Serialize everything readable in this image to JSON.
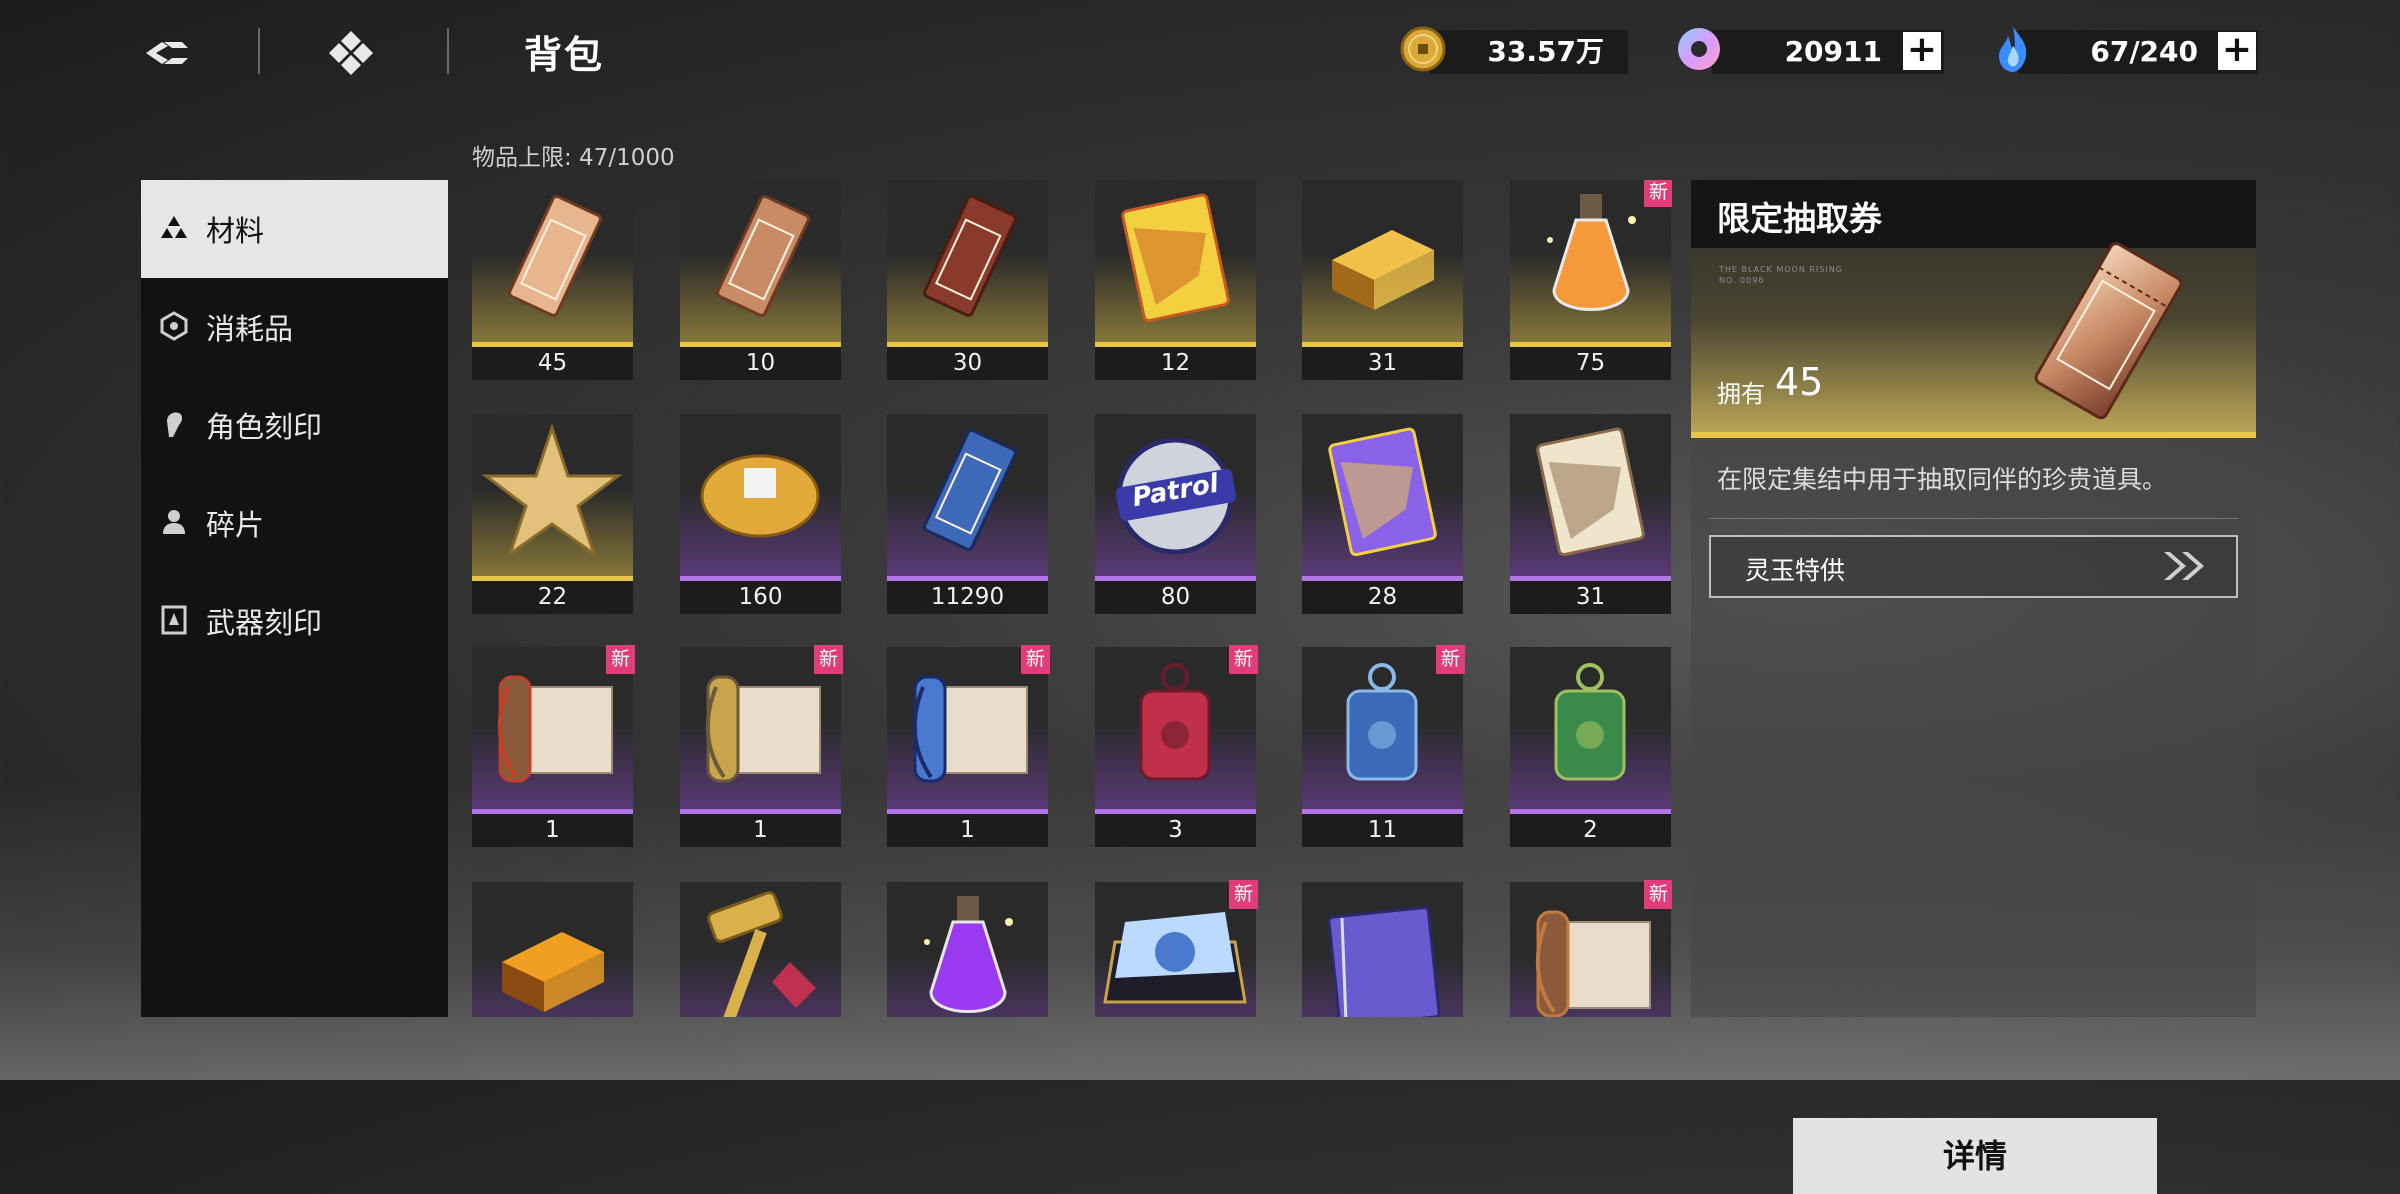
{
  "header": {
    "title": "背包",
    "resources": [
      {
        "icon": "gold-coin-icon",
        "value": "33.57万",
        "has_plus": false
      },
      {
        "icon": "jade-ring-icon",
        "value": "20911",
        "has_plus": true
      },
      {
        "icon": "blue-flame-icon",
        "value": "67/240",
        "has_plus": true
      }
    ],
    "plus_label": "+"
  },
  "sidebar": {
    "items": [
      {
        "label": "材料",
        "icon": "materials-icon",
        "active": true
      },
      {
        "label": "消耗品",
        "icon": "consumables-icon",
        "active": false
      },
      {
        "label": "角色刻印",
        "icon": "character-imprint-icon",
        "active": false
      },
      {
        "label": "碎片",
        "icon": "fragment-icon",
        "active": false
      },
      {
        "label": "武器刻印",
        "icon": "weapon-imprint-icon",
        "active": false
      }
    ]
  },
  "inventory": {
    "limit_text": "物品上限: 47/1000",
    "new_badge": "新",
    "items": [
      {
        "icon": "gold-ticket-icon",
        "count": "45",
        "rarity": "gold",
        "new": false,
        "selected": true
      },
      {
        "icon": "bronze-ticket-icon",
        "count": "10",
        "rarity": "gold",
        "new": false
      },
      {
        "icon": "star-ticket-icon",
        "count": "30",
        "rarity": "gold",
        "new": false
      },
      {
        "icon": "gold-book-icon",
        "count": "12",
        "rarity": "gold",
        "new": false
      },
      {
        "icon": "gold-ingot-icon",
        "count": "31",
        "rarity": "gold",
        "new": false
      },
      {
        "icon": "potion-bottle-icon",
        "count": "75",
        "rarity": "gold",
        "new": true
      },
      {
        "icon": "gold-star-icon",
        "count": "22",
        "rarity": "gold",
        "new": false
      },
      {
        "icon": "thread-spool-icon",
        "count": "160",
        "rarity": "purple",
        "new": false
      },
      {
        "icon": "blue-ticket-icon",
        "count": "11290",
        "rarity": "purple",
        "new": false
      },
      {
        "icon": "patrol-badge-icon",
        "count": "80",
        "rarity": "purple",
        "new": false,
        "text": "Patrol"
      },
      {
        "icon": "purple-book-icon",
        "count": "28",
        "rarity": "purple",
        "new": false
      },
      {
        "icon": "scroll-book-icon",
        "count": "31",
        "rarity": "purple",
        "new": false
      },
      {
        "icon": "brown-scroll-icon",
        "count": "1",
        "rarity": "purple",
        "new": true
      },
      {
        "icon": "gold-scroll-icon",
        "count": "1",
        "rarity": "purple",
        "new": true
      },
      {
        "icon": "blue-scroll-icon",
        "count": "1",
        "rarity": "purple",
        "new": true
      },
      {
        "icon": "red-charm-icon",
        "count": "3",
        "rarity": "purple",
        "new": true
      },
      {
        "icon": "blue-charm-icon",
        "count": "11",
        "rarity": "purple",
        "new": true
      },
      {
        "icon": "green-charm-icon",
        "count": "2",
        "rarity": "purple",
        "new": false
      },
      {
        "icon": "orange-ingot-icon",
        "count": "",
        "rarity": "purple",
        "new": false
      },
      {
        "icon": "hammer-icon",
        "count": "",
        "rarity": "purple",
        "new": false
      },
      {
        "icon": "purple-potion-icon",
        "count": "",
        "rarity": "purple",
        "new": false
      },
      {
        "icon": "crystal-box-icon",
        "count": "",
        "rarity": "purple",
        "new": true
      },
      {
        "icon": "purple-tome-icon",
        "count": "",
        "rarity": "purple",
        "new": false
      },
      {
        "icon": "bronze-scroll-icon",
        "count": "",
        "rarity": "purple",
        "new": true
      }
    ]
  },
  "detail": {
    "title": "限定抽取券",
    "flavor_line1": "THE BLACK MOON RISING",
    "flavor_line2": "NO. 0096",
    "owned_label": "拥有",
    "owned_value": "45",
    "description": "在限定集结中用于抽取同伴的珍贵道具。",
    "source_label": "灵玉特供",
    "button_label": "详情"
  },
  "colors": {
    "gold": "#e8c64a",
    "purple": "#b374e6",
    "badge": "#e23d7a"
  }
}
